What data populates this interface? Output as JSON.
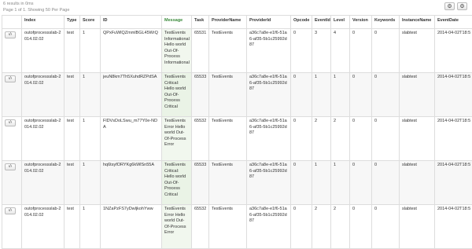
{
  "summary": {
    "results": "6 results in 0ms",
    "page": "Page 1 of 1. Showing 50 Per Page"
  },
  "toolbar": {
    "settings_glyph": "⚙",
    "refresh_glyph": "⚙"
  },
  "table": {
    "headers": [
      "",
      "Index",
      "Type",
      "Score",
      "ID",
      "Message",
      "Task",
      "ProviderName",
      "ProviderId",
      "Opcode",
      "EventId",
      "Level",
      "Version",
      "Keywords",
      "InstanceName",
      "EventDate"
    ],
    "view_glyph": "‹/›",
    "rows": [
      {
        "index": "outofprocessslab-2014.02.02",
        "type": "test",
        "score": "1",
        "id": "QPxFuWlQZmmlBGL45WrQ",
        "message": "TestEvents Informational Hello world Out-Of-Process Informational",
        "task": "65531",
        "provider_name": "TestEvents",
        "provider_id": "a36c7a8e-e1f6-51a6-af35-5b1c25992d87",
        "opcode": "0",
        "event_id": "3",
        "level": "4",
        "version": "0",
        "keywords": "0",
        "instance_name": "slabtest",
        "event_date": "2014-04-02T18:5"
      },
      {
        "index": "outofprocessslab-2014.02.02",
        "type": "test",
        "score": "1",
        "id": "jeuN8km7Th5XuhdRZPdSA",
        "message": "TestEvents Critical: Hello world Out-Of-Process Critical",
        "task": "65533",
        "provider_name": "TestEvents",
        "provider_id": "a36c7a8e-e1f6-51a6-af35-5b1c25992d87",
        "opcode": "0",
        "event_id": "1",
        "level": "1",
        "version": "0",
        "keywords": "0",
        "instance_name": "slabtest",
        "event_date": "2014-04-02T18:5"
      },
      {
        "index": "outofprocessslab-2014.02.02",
        "type": "test",
        "score": "1",
        "id": "FlDVsDoLSwu_m77Y0e-NDA",
        "message": "TestEvents Error Hello world Out-Of-Process Error",
        "task": "65532",
        "provider_name": "TestEvents",
        "provider_id": "a36c7a8e-e1f6-51a6-af35-5b1c25992d87",
        "opcode": "0",
        "event_id": "2",
        "level": "2",
        "version": "0",
        "keywords": "0",
        "instance_name": "slabtest",
        "event_date": "2014-04-02T18:5"
      },
      {
        "index": "outofprocessslab-2014.02.02",
        "type": "test",
        "score": "1",
        "id": "hq6tsyfORYKg6kWlSn55A",
        "message": "TestEvents Critical: Hello world Out-Of-Process Critical",
        "task": "65533",
        "provider_name": "TestEvents",
        "provider_id": "a36c7a8e-e1f6-51a6-af35-5b1c25992d87",
        "opcode": "0",
        "event_id": "1",
        "level": "1",
        "version": "0",
        "keywords": "0",
        "instance_name": "slabtest",
        "event_date": "2014-04-02T18:5"
      },
      {
        "index": "outofprocessslab-2014.02.02",
        "type": "test",
        "score": "1",
        "id": "1NZaPzFS7yDwljkohYww",
        "message": "TestEvents Error Hello world Out-Of-Process Error",
        "task": "65532",
        "provider_name": "TestEvents",
        "provider_id": "a36c7a8e-e1f6-51a6-af35-5b1c25992d87",
        "opcode": "0",
        "event_id": "2",
        "level": "2",
        "version": "0",
        "keywords": "0",
        "instance_name": "slabtest",
        "event_date": "2014-04-02T18:5"
      }
    ]
  }
}
